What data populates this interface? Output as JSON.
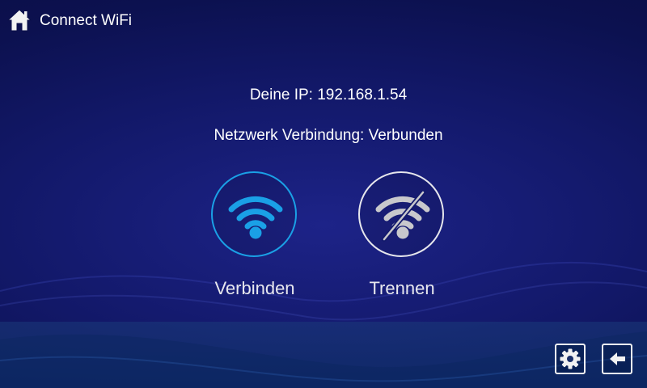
{
  "header": {
    "title": "Connect WiFi",
    "home_icon": "home-icon"
  },
  "status": {
    "ip_text": "Deine IP: 192.168.1.54",
    "connection_text": "Netzwerk Verbindung: Verbunden"
  },
  "actions": {
    "connect_label": "Verbinden",
    "connect_icon": "wifi-icon",
    "disconnect_label": "Trennen",
    "disconnect_icon": "wifi-off-icon"
  },
  "footer": {
    "settings_icon": "gear-icon",
    "back_icon": "arrow-left-icon"
  },
  "colors": {
    "accent": "#1aa0e6",
    "background": "#121868",
    "text": "#ffffff",
    "disabled_icon": "#c8c8cc"
  }
}
